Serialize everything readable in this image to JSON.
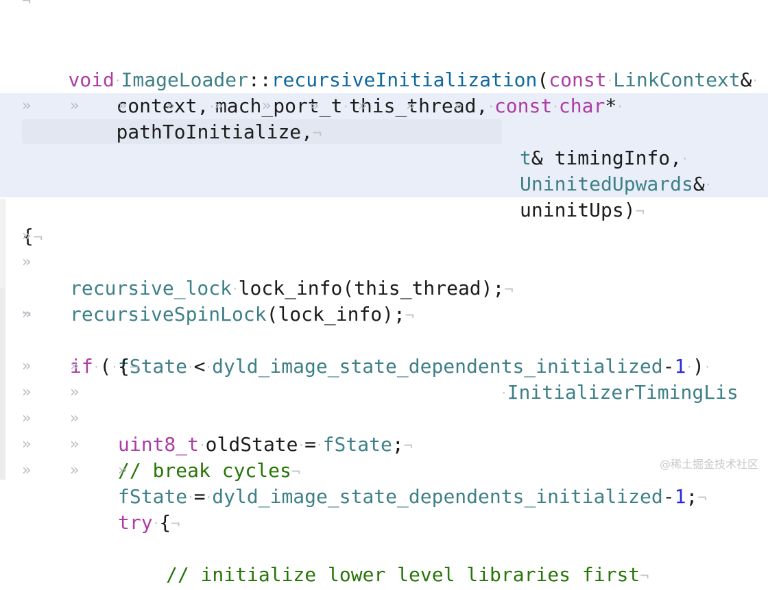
{
  "code": {
    "l1": {
      "kw_void": "void",
      "cls": "ImageLoader",
      "sep": "::",
      "fn": "recursiveInitialization",
      "paren": "(",
      "kw_const": "const",
      "type": "LinkContext",
      "amp": "&"
    },
    "l2": {
      "ident": "context,",
      "type": "mach_port_t",
      "arg": "this_thread,",
      "kw_const": "const",
      "kw_char": "char",
      "star": "*"
    },
    "l3": {
      "ident": "pathToInitialize,"
    },
    "l4": {
      "type": "InitializerTimingLis"
    },
    "l5": {
      "type_tail": "t",
      "rest": "& timingInfo,"
    },
    "l6": {
      "type": "UninitedUpwards",
      "amp": "&"
    },
    "l7": {
      "ident": "uninitUps)"
    },
    "l8": {
      "brace": "{"
    },
    "l9": {
      "type": "recursive_lock",
      "rest": "lock_info(this_thread);"
    },
    "l10": {
      "type": "recursiveSpinLock",
      "rest": "(lock_info);"
    },
    "l12": {
      "kw_if": "if",
      "open": "(",
      "field": "fState",
      "lt": "<",
      "enum": "dyld_image_state_dependents_initialized",
      "minus": "-",
      "num": "1",
      "close": ")"
    },
    "l13": {
      "brace": "{"
    },
    "l14": {
      "type": "uint8_t",
      "var": "oldState",
      "eq": "=",
      "field": "fState",
      "semi": ";"
    },
    "l15": {
      "comment": "// break cycles"
    },
    "l16": {
      "field": "fState",
      "eq": "=",
      "enum": "dyld_image_state_dependents_initialized",
      "minus": "-",
      "num": "1",
      "semi": ";"
    },
    "l17": {
      "kw_try": "try",
      "brace": "{"
    },
    "l18": {
      "comment": "// initialize lower level libraries first"
    }
  },
  "glyphs": {
    "tab": "»",
    "space_dot": "·",
    "return": "¬"
  },
  "watermark": "@稀土掘金技术社区"
}
